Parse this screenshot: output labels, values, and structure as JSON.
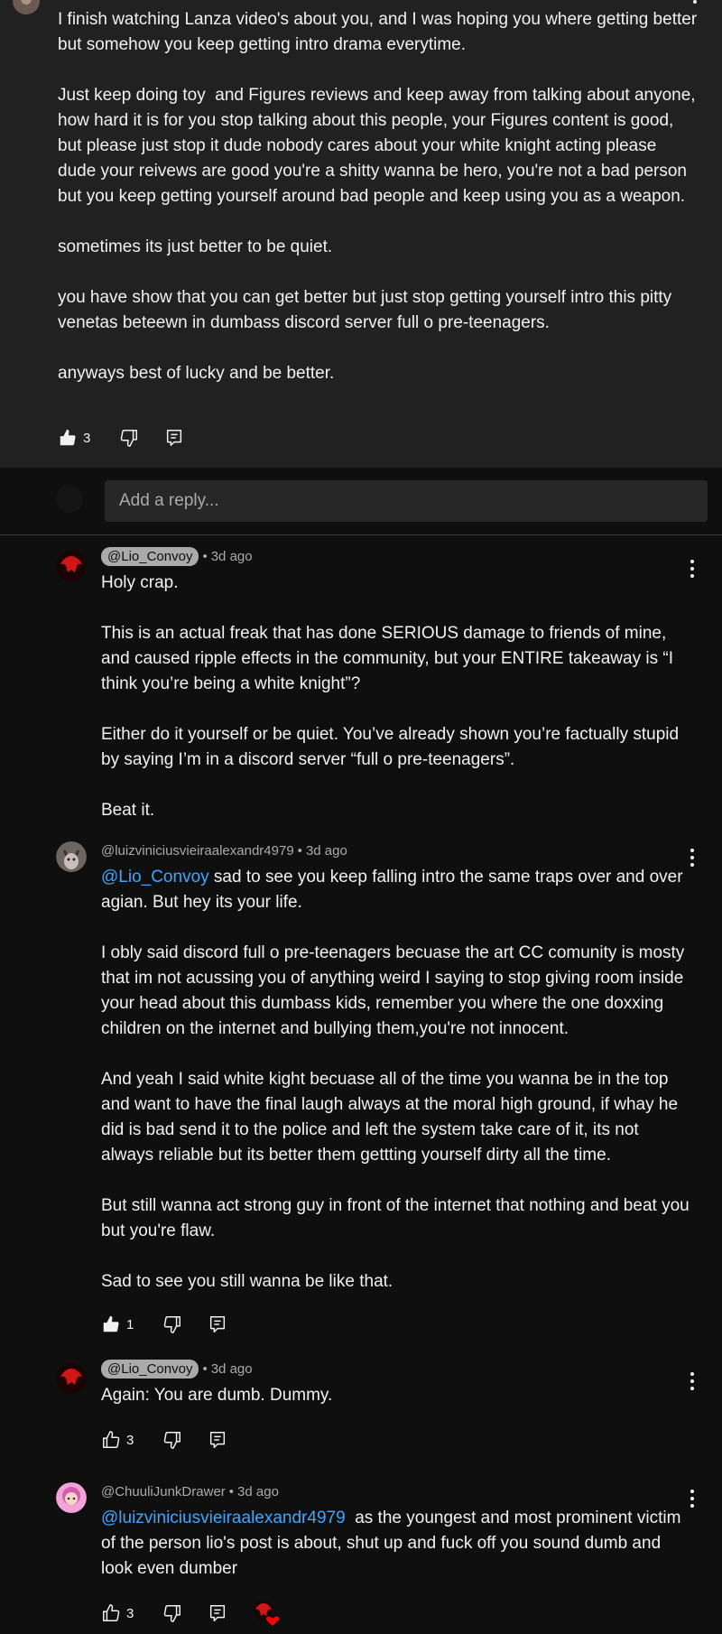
{
  "parent_comment": {
    "text": "I finish watching Lanza video's about you, and I was hoping you where getting better but somehow you keep getting intro drama everytime.\n\nJust keep doing toy  and Figures reviews and keep away from talking about anyone, how hard it is for you stop talking about this people, your Figures content is good, but please just stop it dude nobody cares about your white knight acting please dude your reivews are good you're a shitty wanna be hero, you're not a bad person but you keep getting yourself around bad people and keep using you as a weapon.\n\nsometimes its just better to be quiet.\n\nyou have show that you can get better but just stop getting yourself intro this pitty venetas beteewn in dumbass discord server full o pre-teenagers.\n\nanyways best of lucky and be better.",
    "likes": "3"
  },
  "reply_box": {
    "placeholder": "Add a reply..."
  },
  "replies": [
    {
      "handle": "@Lio_Convoy",
      "time": "3d ago",
      "mention": "",
      "text": "Holy crap.\n\nThis is an actual freak that has done SERIOUS damage to friends of mine, and caused ripple effects in the community, but your ENTIRE takeaway is “I think you’re being a white knight”?\n\nEither do it yourself or be quiet. You’ve already shown you’re factually stupid by saying I’m in a discord server “full o pre-teenagers”.\n\nBeat it.",
      "likes": ""
    },
    {
      "handle": "@luizviniciusvieiraalexandr4979",
      "time": "3d ago",
      "mention": "@Lio_Convoy",
      "text": " sad to see you keep falling intro the same traps over and over agian. But hey its your life.\n\nI obly said discord full o pre-teenagers becuase the art CC comunity is mosty that im not acussing you of anything weird I saying to stop giving room inside your head about this dumbass kids, remember you where the one doxxing children on the internet and bullying them,you're not innocent.\n\nAnd yeah I said white kight becuase all of the time you wanna be in the top and want to have the final laugh always at the moral high ground, if whay he did is bad send it to the police and left the system take care of it, its not always reliable but its better them gettting yourself dirty all the time.\n\nBut still wanna act strong guy in front of the internet that nothing and beat you but you're flaw.\n\nSad to see you still wanna be like that.",
      "likes": "1"
    },
    {
      "handle": "@Lio_Convoy",
      "time": "3d ago",
      "mention": "",
      "text": "Again: You are dumb. Dummy.",
      "likes": "3"
    },
    {
      "handle": "@ChuuliJunkDrawer",
      "time": "3d ago",
      "mention": "@luizviniciusvieiraalexandr4979",
      "text": "  as the youngest and most prominent victim of the person lio's post is about, shut up and fuck off you sound dumb and look even dumber",
      "likes": "3"
    }
  ],
  "colors": {
    "background": "#0f0f0f",
    "parent_background": "#212121",
    "mention": "#3ea6ff",
    "handle_pill": "#aaaaaa",
    "text": "#f1f1f1",
    "meta": "#aaaaaa",
    "creator_heart": "#ff0000"
  },
  "icons": {
    "like": "thumbs-up-icon",
    "dislike": "thumbs-down-icon",
    "reply": "reply-comment-icon",
    "more": "more-vertical-icon",
    "heart": "creator-heart-icon"
  }
}
